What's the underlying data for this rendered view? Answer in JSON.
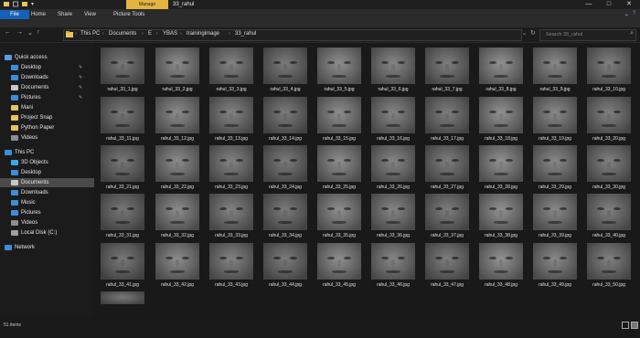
{
  "titlebar": {
    "context_tab": "Manage",
    "window_title": "33_rahul",
    "minimize": "—",
    "maximize": "□",
    "close": "✕"
  },
  "ribbon": {
    "tabs": [
      "File",
      "Home",
      "Share",
      "View",
      "Picture Tools"
    ]
  },
  "address": {
    "nav_back": "←",
    "nav_forward": "→",
    "nav_recent": "⌄",
    "nav_up": "↑",
    "crumbs": [
      "This PC",
      "Documents",
      "E",
      "YBAS",
      "trainingimage",
      "33_rahul"
    ],
    "dropdown": "⌄",
    "refresh": "↻",
    "search_placeholder": "Search 33_rahul",
    "search_icon": "⌕",
    "ribbon_expand": "⌄",
    "help": "?"
  },
  "sidebar": {
    "items": [
      {
        "label": "Quick access",
        "icon": "star-icon",
        "color": "#5a9be6",
        "level": 0,
        "pinned": false
      },
      {
        "label": "Desktop",
        "icon": "desktop-folder-icon",
        "color": "#3a8fd8",
        "level": 1,
        "pinned": true
      },
      {
        "label": "Downloads",
        "icon": "download-icon",
        "color": "#3a8fd8",
        "level": 1,
        "pinned": true
      },
      {
        "label": "Documents",
        "icon": "document-icon",
        "color": "#c8c8c8",
        "level": 1,
        "pinned": true
      },
      {
        "label": "Pictures",
        "icon": "picture-icon",
        "color": "#3a8fd8",
        "level": 1,
        "pinned": true
      },
      {
        "label": "Mani",
        "icon": "folder-icon",
        "color": "#e8c45a",
        "level": 1,
        "pinned": false
      },
      {
        "label": "Project Snap",
        "icon": "folder-icon",
        "color": "#e8c45a",
        "level": 1,
        "pinned": false
      },
      {
        "label": "Python Paper",
        "icon": "folder-icon",
        "color": "#e8c45a",
        "level": 1,
        "pinned": false
      },
      {
        "label": "Videos",
        "icon": "video-icon",
        "color": "#8e8e8e",
        "level": 1,
        "pinned": false
      },
      {
        "label": "This PC",
        "icon": "computer-icon",
        "color": "#3a8fd8",
        "level": 0,
        "pinned": false
      },
      {
        "label": "3D Objects",
        "icon": "cube-icon",
        "color": "#3aa8e8",
        "level": 1,
        "pinned": false
      },
      {
        "label": "Desktop",
        "icon": "desktop-folder-icon",
        "color": "#3a8fd8",
        "level": 1,
        "pinned": false
      },
      {
        "label": "Documents",
        "icon": "document-icon",
        "color": "#c8c8c8",
        "level": 1,
        "pinned": false,
        "selected": true
      },
      {
        "label": "Downloads",
        "icon": "download-icon",
        "color": "#3a8fd8",
        "level": 1,
        "pinned": false
      },
      {
        "label": "Music",
        "icon": "music-icon",
        "color": "#3a8fd8",
        "level": 1,
        "pinned": false
      },
      {
        "label": "Pictures",
        "icon": "picture-icon",
        "color": "#3a8fd8",
        "level": 1,
        "pinned": false
      },
      {
        "label": "Videos",
        "icon": "video-icon",
        "color": "#8e8e8e",
        "level": 1,
        "pinned": false
      },
      {
        "label": "Local Disk (C:)",
        "icon": "drive-icon",
        "color": "#9aa0a6",
        "level": 1,
        "pinned": false
      },
      {
        "label": "Network",
        "icon": "network-icon",
        "color": "#3a8fd8",
        "level": 0,
        "pinned": false
      }
    ],
    "pin_glyph": "✎"
  },
  "files": [
    "rahul_33_1.jpg",
    "rahul_33_2.jpg",
    "rahul_33_3.jpg",
    "rahul_33_4.jpg",
    "rahul_33_5.jpg",
    "rahul_33_6.jpg",
    "rahul_33_7.jpg",
    "rahul_33_8.jpg",
    "rahul_33_9.jpg",
    "rahul_33_10.jpg",
    "rahul_33_11.jpg",
    "rahul_33_12.jpg",
    "rahul_33_13.jpg",
    "rahul_33_14.jpg",
    "rahul_33_15.jpg",
    "rahul_33_16.jpg",
    "rahul_33_17.jpg",
    "rahul_33_18.jpg",
    "rahul_33_19.jpg",
    "rahul_33_20.jpg",
    "rahul_33_21.jpg",
    "rahul_33_22.jpg",
    "rahul_33_23.jpg",
    "rahul_33_24.jpg",
    "rahul_33_25.jpg",
    "rahul_33_26.jpg",
    "rahul_33_27.jpg",
    "rahul_33_28.jpg",
    "rahul_33_29.jpg",
    "rahul_33_30.jpg",
    "rahul_33_31.jpg",
    "rahul_33_32.jpg",
    "rahul_33_33.jpg",
    "rahul_33_34.jpg",
    "rahul_33_35.jpg",
    "rahul_33_36.jpg",
    "rahul_33_37.jpg",
    "rahul_33_38.jpg",
    "rahul_33_39.jpg",
    "rahul_33_40.jpg",
    "rahul_33_41.jpg",
    "rahul_33_42.jpg",
    "rahul_33_43.jpg",
    "rahul_33_44.jpg",
    "rahul_33_45.jpg",
    "rahul_33_46.jpg",
    "rahul_33_47.jpg",
    "rahul_33_48.jpg",
    "rahul_33_49.jpg",
    "rahul_33_50.jpg",
    ""
  ],
  "status": {
    "item_count": "51 items",
    "view_details_icon": "details-view-icon",
    "view_thumbs_icon": "large-icons-view-icon"
  },
  "colors": {
    "accent": "#1560b8",
    "context_tab": "#e3b441",
    "selection": "#4a4a4a"
  }
}
